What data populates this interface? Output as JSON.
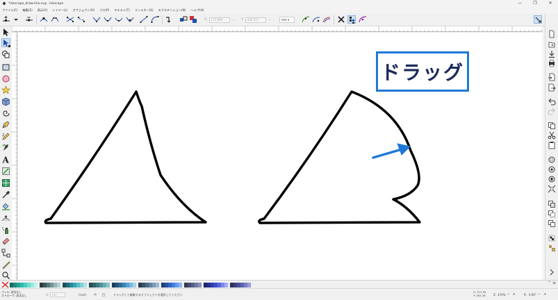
{
  "window": {
    "title": "*Inkscape_draw-line.svg - Inkscape",
    "controls": [
      "—",
      "❐",
      "✕"
    ]
  },
  "menubar": {
    "items": [
      "ファイル(F)",
      "編集(E)",
      "表示(V)",
      "レイヤー(L)",
      "オブジェクト(O)",
      "パス(P)",
      "テキスト(T)",
      "フィルター(S)",
      "エクステンション(N)",
      "ヘルプ(H)"
    ]
  },
  "toolcontrols": {
    "x_label": "X:",
    "x_value": "111.908",
    "y_label": "Y:",
    "y_value": "266.551",
    "unit": "mm",
    "stepper": "- +"
  },
  "canvas": {
    "callout_text": "ドラッグ",
    "callout_border_color": "#1e78d6",
    "arrow_color": "#1e78d6"
  },
  "status": {
    "fill_label": "フィル:",
    "fill_value": "該当なし",
    "stroke_label": "ストローク:",
    "stroke_value": "該当なし",
    "opacity_label": "O:",
    "opacity_value": "100",
    "layer": "[root]",
    "message": "ドラッグして編集するオブジェクトを選択してください",
    "x_label": "X:",
    "x_value": "113.92",
    "y_label": "Y:",
    "y_value": "261.38",
    "zoom_label": "Z:",
    "zoom_value": "470%",
    "rotation_label": "R:",
    "rotation_value": "0.00°"
  },
  "palette": {
    "colors": [
      "#1b6a63",
      "#1f8a7e",
      "#25a596",
      "#2dbcac",
      "#47cfbe",
      "#6ddccd",
      "#98e8dd",
      "#c4f2ec",
      "#2a3a3c",
      "#3e5658",
      "#567577",
      "#739597",
      "#95b3b4",
      "#b8cfd0",
      "#18505a",
      "#1e6c78",
      "#268896",
      "#35a3b0",
      "#56bcc7",
      "#80d1d9",
      "#acE3e8",
      "#244d52",
      "#2f6369",
      "#3c7b82",
      "#4d939a",
      "#66acb2",
      "#86c4c9",
      "#1a3d5c",
      "#235379",
      "#2e6b97",
      "#3b85b5",
      "#54a0cf",
      "#78b9e0",
      "#a3d1ee",
      "#2b3d4f",
      "#3a5269",
      "#4b6984",
      "#5f819f",
      "#7a9bb8",
      "#9ab6cf",
      "#1e3f7a",
      "#27529e",
      "#3166c0",
      "#427edb",
      "#6298ea",
      "#8ab3f3",
      "#333a52",
      "#444d6d",
      "#566188",
      "#6c77a3",
      "#8791bd",
      "#1a2570",
      "#23308f",
      "#2e3dae",
      "#3d4dca",
      "#5666dc",
      "#7a87ea",
      "#a2abf3",
      "#2d2f5c",
      "#3b3e78",
      "#4b4f94",
      "#5e63ae",
      "#787dc6",
      "#979bdb"
    ]
  }
}
